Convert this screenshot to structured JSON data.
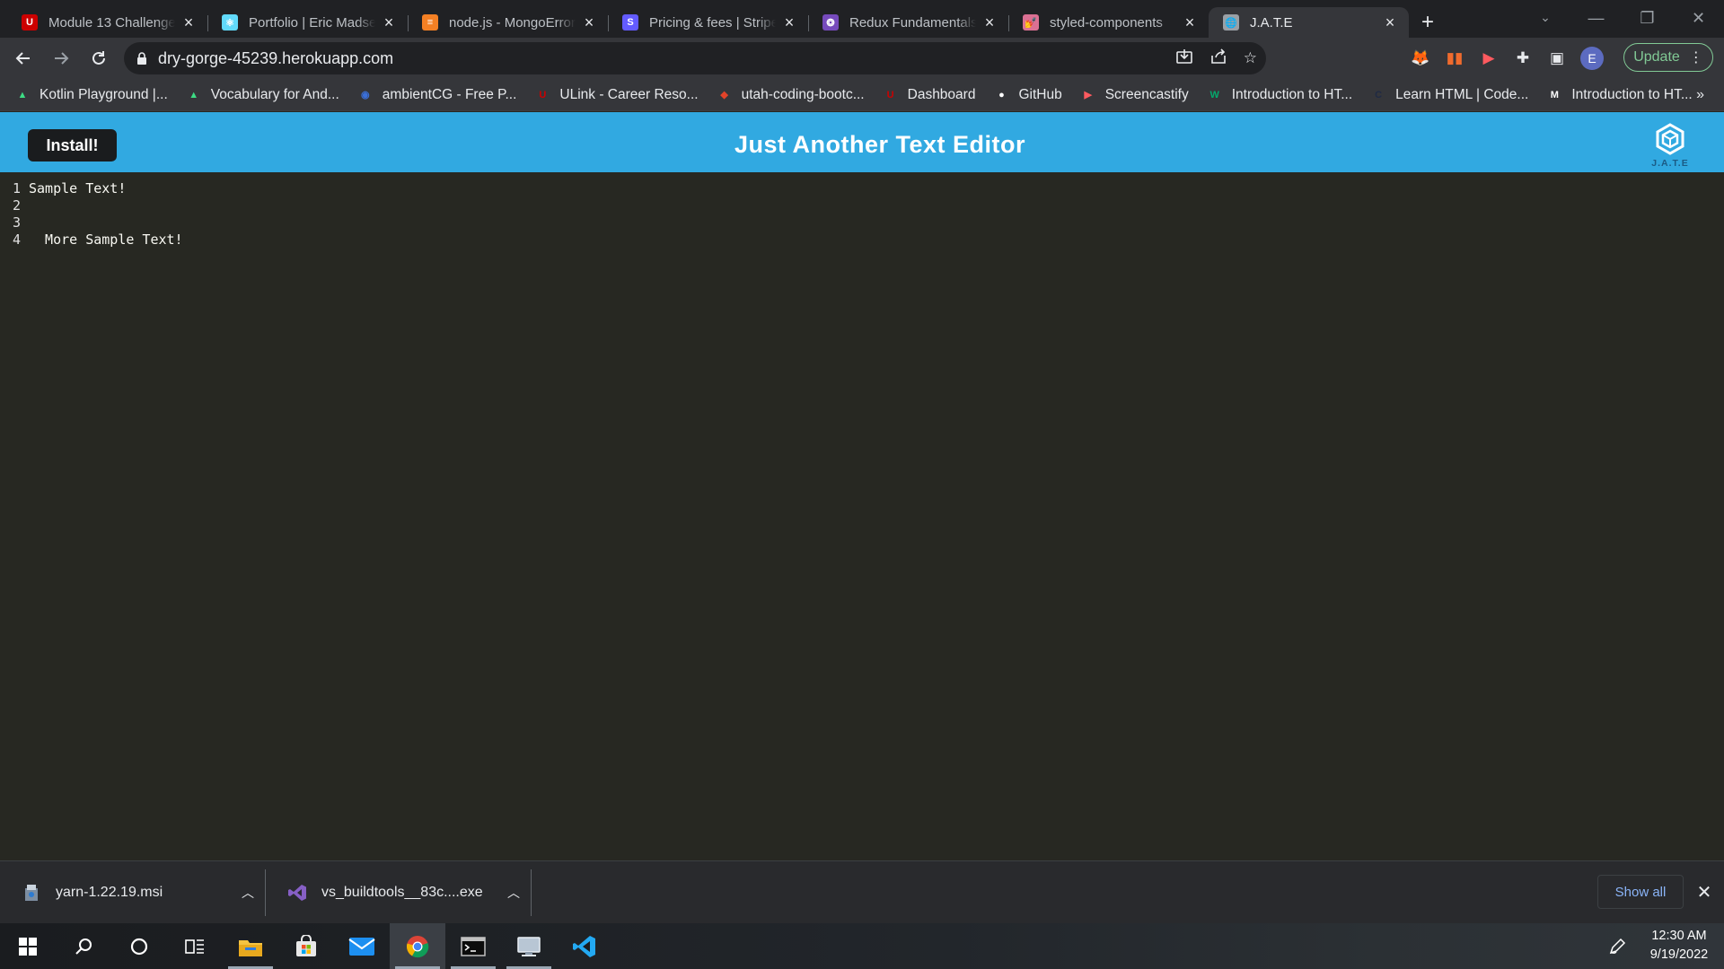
{
  "browser": {
    "tabs": [
      {
        "title": "Module 13 Challenge",
        "favicon": "utah-u-icon",
        "favicon_color": "#cc0000",
        "favicon_char": "U"
      },
      {
        "title": "Portfolio | Eric Madsen",
        "favicon": "react-icon",
        "favicon_color": "#61dafb",
        "favicon_char": "⚛"
      },
      {
        "title": "node.js - MongoError",
        "favicon": "stackoverflow-icon",
        "favicon_color": "#f48024",
        "favicon_char": "≡"
      },
      {
        "title": "Pricing & fees | Stripe",
        "favicon": "stripe-icon",
        "favicon_color": "#635bff",
        "favicon_char": "S"
      },
      {
        "title": "Redux Fundamentals,",
        "favicon": "redux-icon",
        "favicon_color": "#764abc",
        "favicon_char": "❂"
      },
      {
        "title": "styled-components",
        "favicon": "styled-components-icon",
        "favicon_color": "#db7093",
        "favicon_char": "💅"
      },
      {
        "title": "J.A.T.E",
        "favicon": "globe-icon",
        "favicon_color": "#9aa0a6",
        "favicon_char": "🌐",
        "active": true
      }
    ],
    "url": "dry-gorge-45239.herokuapp.com",
    "update_label": "Update",
    "profile_initial": "E",
    "bookmarks": [
      {
        "label": "Kotlin Playground |...",
        "icon": "android-icon",
        "color": "#3ddc84",
        "char": "▲"
      },
      {
        "label": "Vocabulary for And...",
        "icon": "android-icon",
        "color": "#3ddc84",
        "char": "▲"
      },
      {
        "label": "ambientCG - Free P...",
        "icon": "ambientcg-icon",
        "color": "#3a6fd8",
        "char": "◉"
      },
      {
        "label": "ULink - Career Reso...",
        "icon": "utah-u-icon",
        "color": "#cc0000",
        "char": "U"
      },
      {
        "label": "utah-coding-bootc...",
        "icon": "gitlab-icon",
        "color": "#e24329",
        "char": "◆"
      },
      {
        "label": "Dashboard",
        "icon": "utah-u-icon",
        "color": "#cc0000",
        "char": "U"
      },
      {
        "label": "GitHub",
        "icon": "github-icon",
        "color": "#ffffff",
        "char": "●"
      },
      {
        "label": "Screencastify",
        "icon": "screencastify-icon",
        "color": "#ff5a5f",
        "char": "▶"
      },
      {
        "label": "Introduction to HT...",
        "icon": "w3-icon",
        "color": "#04aa6d",
        "char": "W"
      },
      {
        "label": "Learn HTML | Code...",
        "icon": "codecademy-icon",
        "color": "#1f2a44",
        "char": "C"
      },
      {
        "label": "Introduction to HT...",
        "icon": "mdn-icon",
        "color": "#ffffff",
        "char": "M"
      }
    ],
    "bookmarks_more": "»"
  },
  "app": {
    "title": "Just Another Text Editor",
    "install_label": "Install!",
    "logo_text": "J.A.T.E",
    "header_color": "#31a9e1"
  },
  "editor": {
    "lines": [
      {
        "number": "1",
        "text": "Sample Text!"
      },
      {
        "number": "2",
        "text": ""
      },
      {
        "number": "3",
        "text": ""
      },
      {
        "number": "4",
        "text": "  More Sample Text!"
      }
    ]
  },
  "downloads": {
    "items": [
      {
        "name": "yarn-1.22.19.msi",
        "icon": "installer-icon"
      },
      {
        "name": "vs_buildtools__83c....exe",
        "icon": "visual-studio-icon"
      }
    ],
    "show_all_label": "Show all"
  },
  "taskbar": {
    "time": "12:30 AM",
    "date": "9/19/2022"
  }
}
